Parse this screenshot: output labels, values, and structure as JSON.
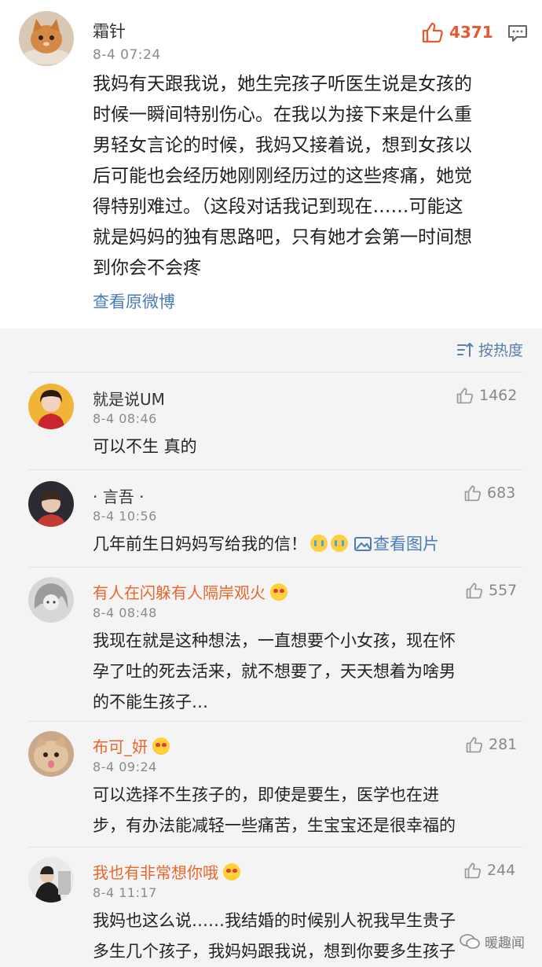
{
  "post": {
    "username": "霜针",
    "time": "8-4 07:24",
    "likes": "4371",
    "lines": [
      "我妈有天跟我说，她生完孩子听医生说是女孩的",
      "时候一瞬间特别伤心。在我以为接下来是什么重",
      "男轻女言论的时候，我妈又接着说，想到女孩以",
      "后可能也会经历她刚刚经历过的这些疼痛，她觉",
      "得特别难过。（这段对话我记到现在……可能这",
      "就是妈妈的独有思路吧，只有她才会第一时间想",
      "到你会不会疼"
    ],
    "view_original": "查看原微博"
  },
  "sort": {
    "label": "按热度"
  },
  "comments": [
    {
      "username": "就是说UM",
      "time": "8-4 08:46",
      "likes": "1462",
      "lines": [
        "可以不生 真的"
      ]
    },
    {
      "username": "· 言吾 ·",
      "time": "8-4 10:56",
      "likes": "683",
      "lines": [
        "几年前生日妈妈写给我的信！"
      ],
      "view_image": "查看图片"
    },
    {
      "username": "有人在闪躲有人隔岸观火",
      "time": "8-4 08:48",
      "likes": "557",
      "lines": [
        "我现在就是这种想法，一直想要个小女孩，现在怀",
        "孕了吐的死去活来，就不想要了，天天想着为啥男",
        "的不能生孩子…"
      ]
    },
    {
      "username": "布可_妍",
      "time": "8-4 09:24",
      "likes": "281",
      "lines": [
        "可以选择不生孩子的，即使是要生，医学也在进",
        "步，有办法能减轻一些痛苦，生宝宝还是很幸福的"
      ]
    },
    {
      "username": "我也有非常想你哦",
      "time": "8-4 11:17",
      "likes": "244",
      "lines": [
        "我妈也这么说……我结婚的时候别人祝我早生贵子",
        "多生几个孩子，我妈妈跟我说，想到你要多生孩子"
      ]
    }
  ],
  "watermark": {
    "text": "暖趣闻"
  },
  "colors": {
    "link": "#4a7db6",
    "vip_name": "#e9662c",
    "like_hot": "#e8582f"
  }
}
